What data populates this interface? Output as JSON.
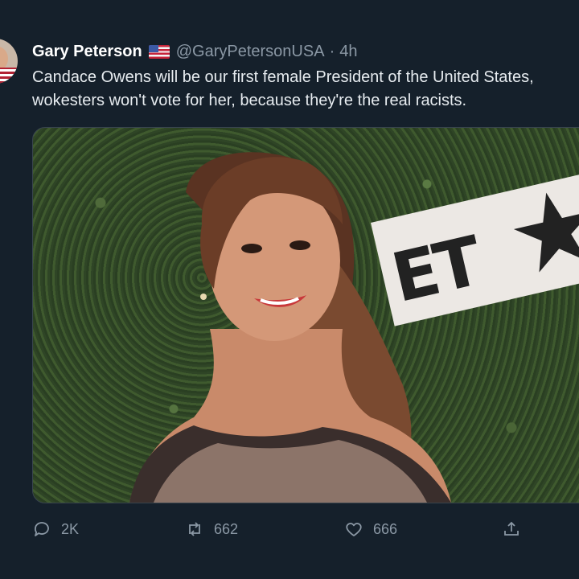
{
  "tweet": {
    "author_name": "Gary Peterson",
    "author_handle": "@GaryPetersonUSA",
    "separator": "·",
    "time": "4h",
    "text_line1": "Candace Owens will be our first female President of the United States,",
    "text_line2": "wokesters won't vote for her, because they're the real racists.",
    "flag_icon": "us-flag-icon",
    "media_sign_text": "ET"
  },
  "actions": {
    "reply_count": "2K",
    "retweet_count": "662",
    "like_count": "666",
    "icons": [
      "reply-icon",
      "retweet-icon",
      "heart-icon",
      "share-icon"
    ]
  },
  "colors": {
    "background": "#15202b",
    "text": "#e7ecf0",
    "secondary": "#8b98a5",
    "border": "#38444d"
  }
}
